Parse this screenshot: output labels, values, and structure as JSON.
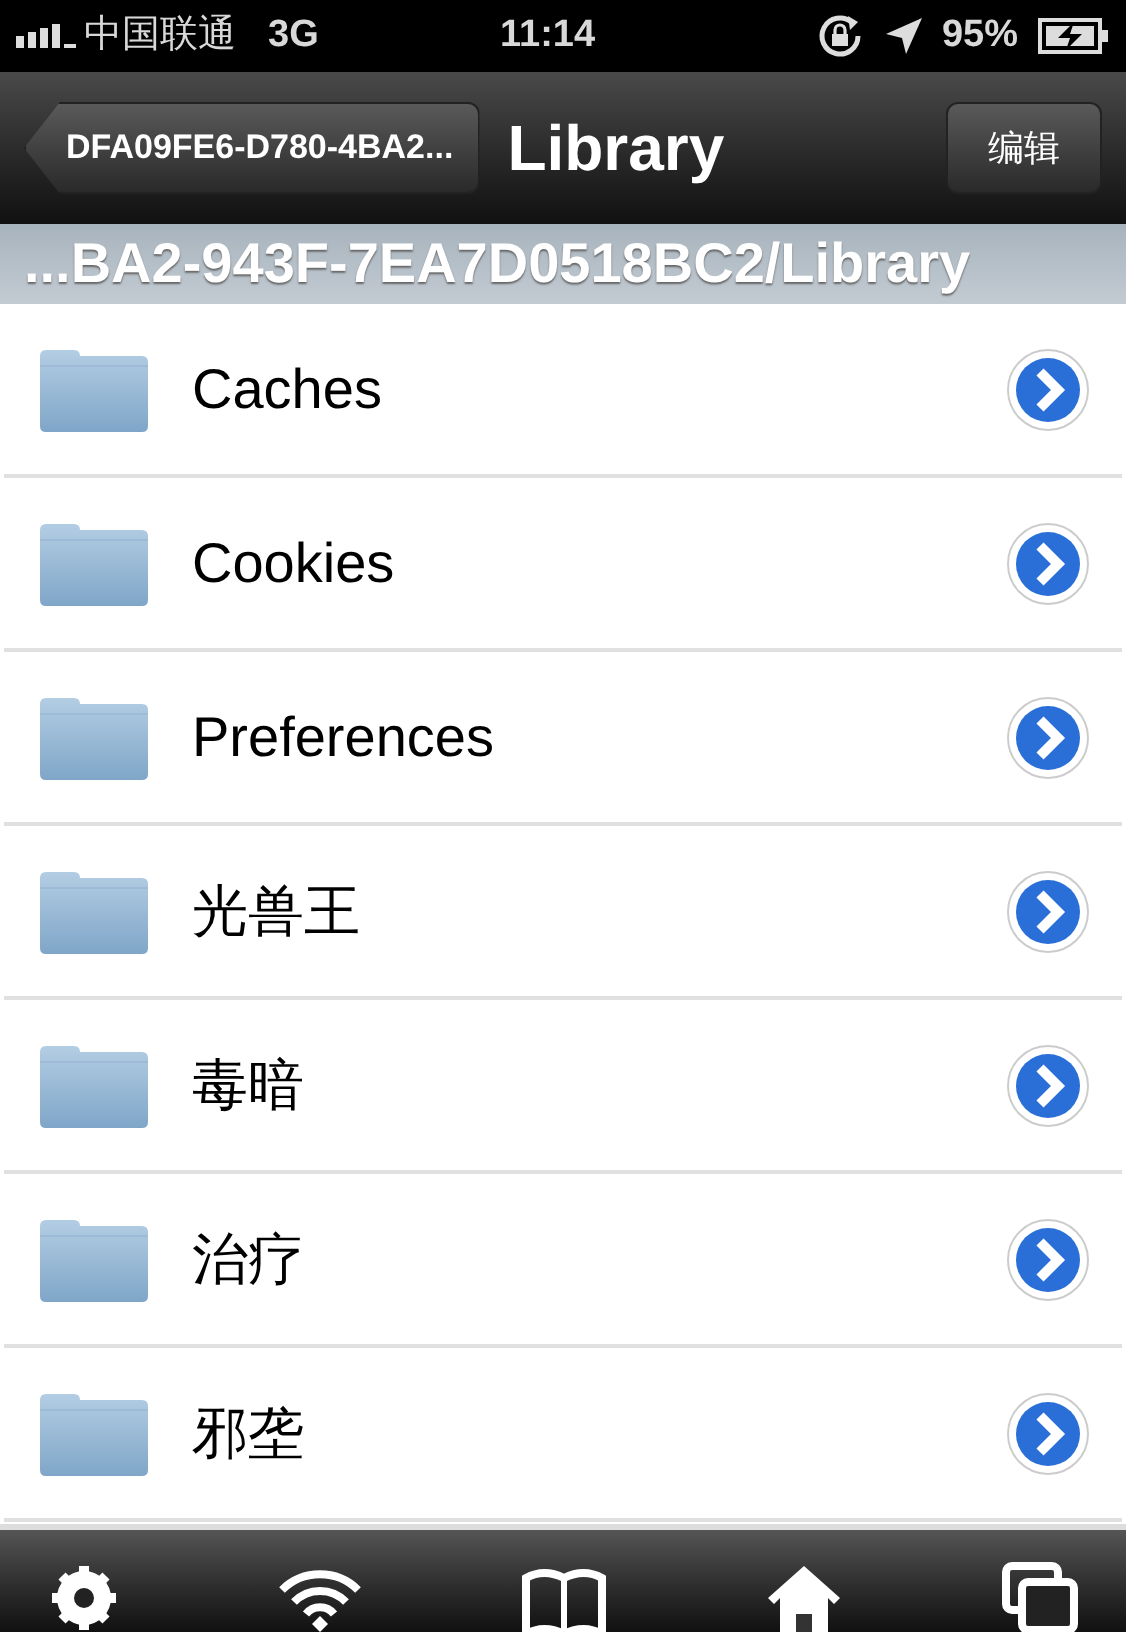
{
  "status_bar": {
    "carrier": "中国联通",
    "network": "3G",
    "time": "11:14",
    "battery": "95%"
  },
  "nav_bar": {
    "back": "DFA09FE6-D780-4BA2...",
    "title": "Library",
    "edit": "编辑"
  },
  "path_bar": "...BA2-943F-7EA7D0518BC2/Library",
  "items": [
    {
      "name": "Caches"
    },
    {
      "name": "Cookies"
    },
    {
      "name": "Preferences"
    },
    {
      "name": "光兽王"
    },
    {
      "name": "毒暗"
    },
    {
      "name": "治疗"
    },
    {
      "name": "邪垄"
    }
  ]
}
